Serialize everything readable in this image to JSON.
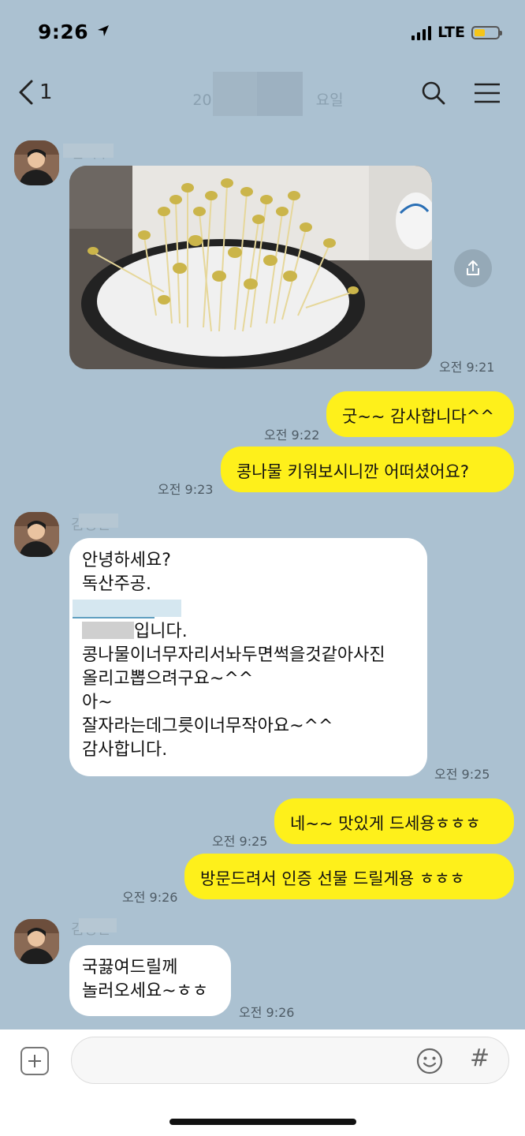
{
  "status_bar": {
    "time": "9:26",
    "network": "LTE"
  },
  "header": {
    "unread_count": "1",
    "title_partial_left": "20",
    "title_partial_right": "요일"
  },
  "messages": {
    "m1": {
      "sender": "김석수",
      "timestamp": "오전 9:21"
    },
    "m2": {
      "text": "굿~~ 감사합니다^^",
      "timestamp": "오전 9:22"
    },
    "m3": {
      "text": "콩나물 키워보시니깐 어떠셨어요?",
      "timestamp": "오전 9:23"
    },
    "m4": {
      "sender": "김영민",
      "lines": [
        "안녕하세요?",
        "독산주공.",
        "",
        "입니다.",
        "콩나물이너무자리서놔두면썩을것같아사진",
        "올리고뽑으려구요~^^",
        "아~",
        "잘자라는데그릇이너무작아요~^^",
        "감사합니다."
      ],
      "timestamp": "오전 9:25"
    },
    "m5": {
      "text": "네~~ 맛있게 드세용ㅎㅎㅎ",
      "timestamp": "오전 9:25"
    },
    "m6": {
      "text": "방문드려서 인증 선물 드릴게용 ㅎㅎㅎ",
      "timestamp": "오전 9:26"
    },
    "m7": {
      "sender": "김영민",
      "lines": [
        "국끓여드릴께",
        "놀러오세요~ㅎㅎ"
      ],
      "timestamp": "오전 9:26"
    }
  },
  "input": {
    "value": "",
    "placeholder": "",
    "hash_symbol": "#"
  },
  "colors": {
    "background": "#abc1d1",
    "my_bubble": "#fef01b",
    "their_bubble": "#ffffff"
  }
}
